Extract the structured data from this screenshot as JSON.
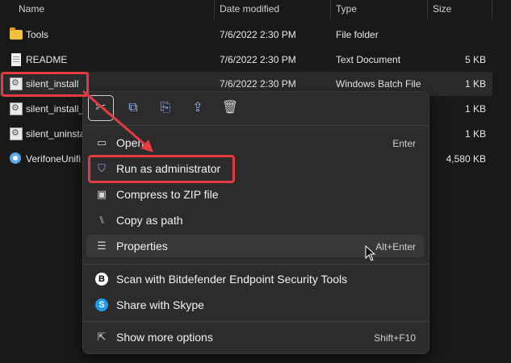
{
  "columns": {
    "name": "Name",
    "date": "Date modified",
    "type": "Type",
    "size": "Size"
  },
  "files": [
    {
      "name": "Tools",
      "date": "7/6/2022 2:30 PM",
      "type": "File folder",
      "size": "",
      "icon": "folder-icon"
    },
    {
      "name": "README",
      "date": "7/6/2022 2:30 PM",
      "type": "Text Document",
      "size": "5 KB",
      "icon": "text-document-icon"
    },
    {
      "name": "silent_install",
      "date": "7/6/2022 2:30 PM",
      "type": "Windows Batch File",
      "size": "1 KB",
      "icon": "batch-file-icon"
    },
    {
      "name": "silent_install_",
      "date": "",
      "type": "",
      "size": "1 KB",
      "icon": "batch-file-icon"
    },
    {
      "name": "silent_uninsta",
      "date": "",
      "type": "",
      "size": "1 KB",
      "icon": "batch-file-icon"
    },
    {
      "name": "VerifoneUnifi",
      "date": "",
      "type": "",
      "size": "4,580 KB",
      "icon": "installer-icon"
    }
  ],
  "context_toolbar": [
    {
      "name": "cut-icon",
      "glyph": "✂"
    },
    {
      "name": "copy-icon",
      "glyph": "⧉"
    },
    {
      "name": "rename-icon",
      "glyph": "⎘"
    },
    {
      "name": "share-icon",
      "glyph": "⇪"
    },
    {
      "name": "delete-icon",
      "glyph": "🗑"
    }
  ],
  "menu": {
    "open": {
      "label": "Open",
      "shortcut": "Enter",
      "icon": "open-window-icon"
    },
    "run_admin": {
      "label": "Run as administrator",
      "shortcut": "",
      "icon": "shield-icon"
    },
    "compress": {
      "label": "Compress to ZIP file",
      "shortcut": "",
      "icon": "zip-folder-icon"
    },
    "copy_path": {
      "label": "Copy as path",
      "shortcut": "",
      "icon": "path-icon"
    },
    "properties": {
      "label": "Properties",
      "shortcut": "Alt+Enter",
      "icon": "properties-icon"
    },
    "bitdefender": {
      "label": "Scan with Bitdefender Endpoint Security Tools",
      "shortcut": "",
      "icon": "bitdefender-icon",
      "glyph": "B"
    },
    "skype": {
      "label": "Share with Skype",
      "shortcut": "",
      "icon": "skype-icon",
      "glyph": "S"
    },
    "more": {
      "label": "Show more options",
      "shortcut": "Shift+F10",
      "icon": "more-options-icon"
    }
  },
  "colors": {
    "highlight": "#e23b42",
    "accent": "#8ab4f8",
    "background": "#191919",
    "menu": "#2c2c2c"
  }
}
